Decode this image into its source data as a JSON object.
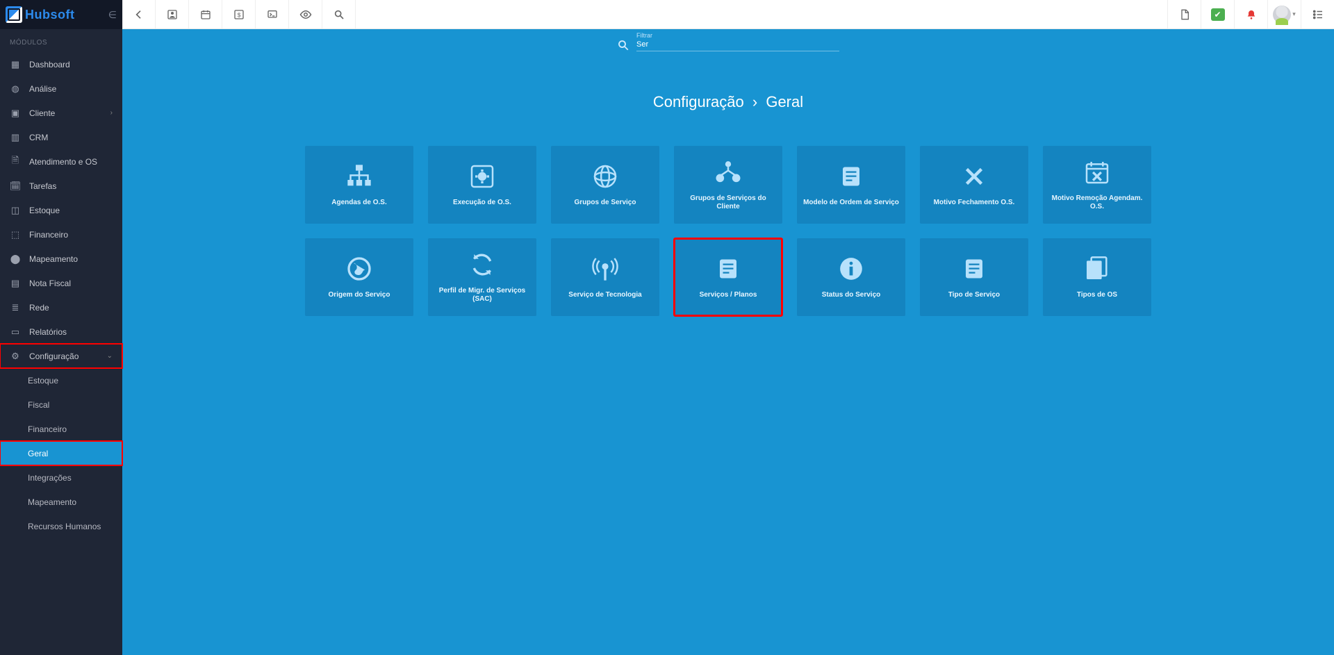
{
  "brand": {
    "name_a": "Hub",
    "name_b": "soft"
  },
  "sidebar": {
    "section_label": "MÓDULOS",
    "items": [
      {
        "label": "Dashboard",
        "icon": "dashboard"
      },
      {
        "label": "Análise",
        "icon": "globe"
      },
      {
        "label": "Cliente",
        "icon": "id-card",
        "expandable": true
      },
      {
        "label": "CRM",
        "icon": "grid"
      },
      {
        "label": "Atendimento e OS",
        "icon": "clipboard"
      },
      {
        "label": "Tarefas",
        "icon": "calendar"
      },
      {
        "label": "Estoque",
        "icon": "box"
      },
      {
        "label": "Financeiro",
        "icon": "money"
      },
      {
        "label": "Mapeamento",
        "icon": "pin"
      },
      {
        "label": "Nota Fiscal",
        "icon": "receipt"
      },
      {
        "label": "Rede",
        "icon": "bars"
      },
      {
        "label": "Relatórios",
        "icon": "chart"
      },
      {
        "label": "Configuração",
        "icon": "gear",
        "expandable": true,
        "expanded": true,
        "highlighted": true
      }
    ],
    "subitems": [
      {
        "label": "Estoque"
      },
      {
        "label": "Fiscal"
      },
      {
        "label": "Financeiro"
      },
      {
        "label": "Geral",
        "active": true,
        "highlighted": true
      },
      {
        "label": "Integrações"
      },
      {
        "label": "Mapeamento"
      },
      {
        "label": "Recursos Humanos"
      }
    ]
  },
  "topbar": {
    "left_icons": [
      "back",
      "person",
      "calendar",
      "dollar",
      "terminal",
      "eye",
      "search"
    ],
    "right_icons": [
      "pdf",
      "check",
      "bell",
      "avatar",
      "list"
    ]
  },
  "filter": {
    "label": "Filtrar",
    "value": "Ser"
  },
  "breadcrumb": {
    "a": "Configuração",
    "b": "Geral"
  },
  "tiles": [
    {
      "label": "Agendas de O.S.",
      "icon": "sitemap"
    },
    {
      "label": "Execução de O.S.",
      "icon": "gearbox"
    },
    {
      "label": "Grupos de Serviço",
      "icon": "globe-grid"
    },
    {
      "label": "Grupos de Serviços do Cliente",
      "icon": "nodes"
    },
    {
      "label": "Modelo de Ordem de Serviço",
      "icon": "doc"
    },
    {
      "label": "Motivo Fechamento O.S.",
      "icon": "close"
    },
    {
      "label": "Motivo Remoção Agendam. O.S.",
      "icon": "cal-x"
    },
    {
      "label": "Origem do Serviço",
      "icon": "world"
    },
    {
      "label": "Perfil de Migr. de Serviços (SAC)",
      "icon": "sync"
    },
    {
      "label": "Serviço de Tecnologia",
      "icon": "antenna"
    },
    {
      "label": "Serviços / Planos",
      "icon": "doc",
      "highlighted": true
    },
    {
      "label": "Status do Serviço",
      "icon": "info"
    },
    {
      "label": "Tipo de Serviço",
      "icon": "doc"
    },
    {
      "label": "Tipos de OS",
      "icon": "docs"
    }
  ]
}
